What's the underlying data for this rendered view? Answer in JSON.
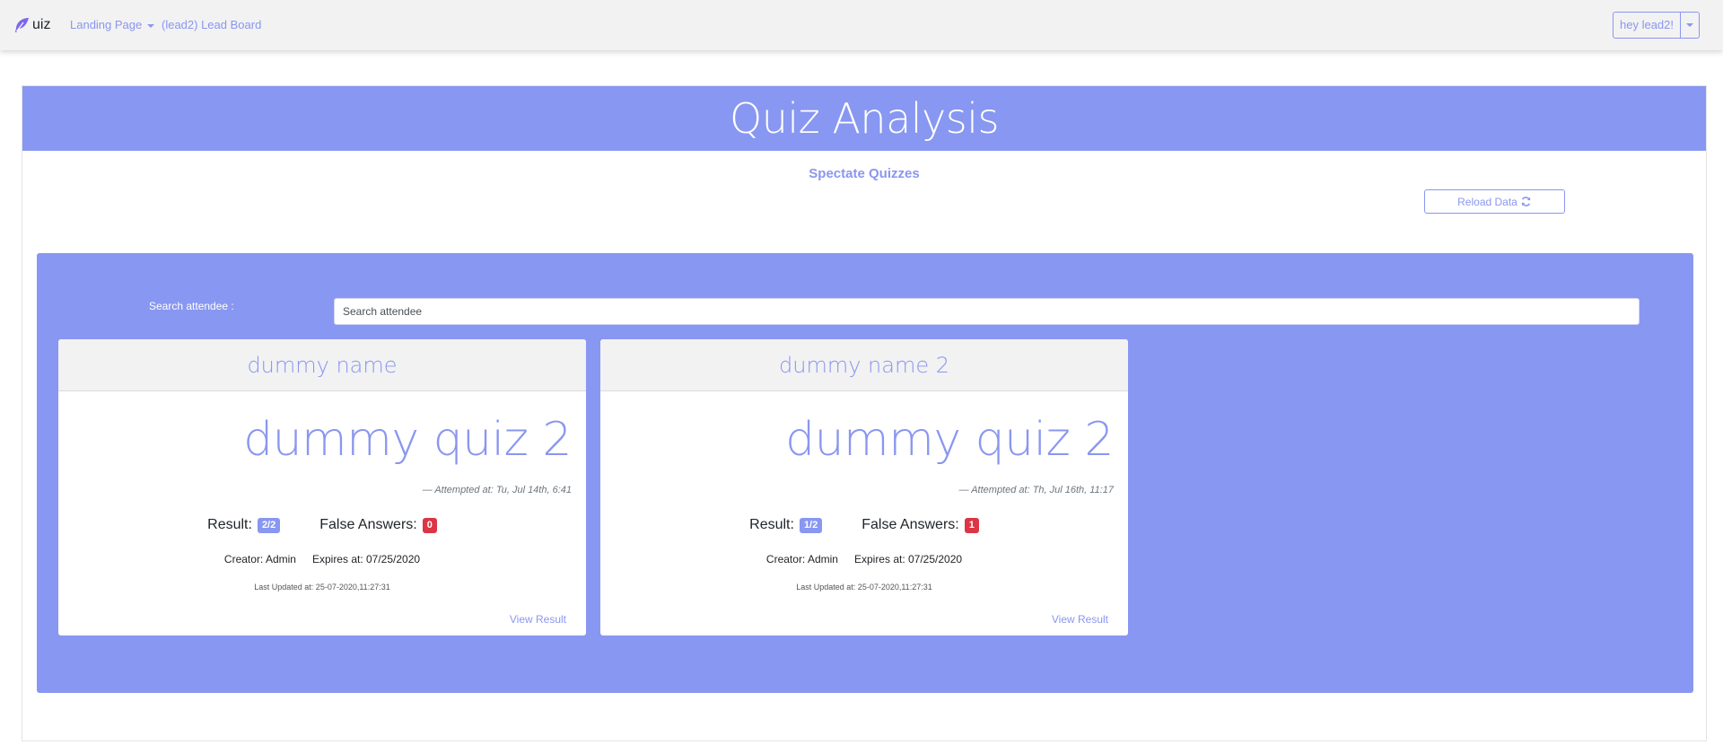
{
  "navbar": {
    "brand_text": "uiz",
    "landing_label": "Landing Page",
    "leadboard_label": "(lead2) Lead Board",
    "user_label": "hey lead2!"
  },
  "page": {
    "title": "Quiz Analysis",
    "subtitle": "Spectate Quizzes",
    "reload_label": "Reload Data"
  },
  "search": {
    "label": "Search attendee :",
    "placeholder": "Search attendee"
  },
  "cards": [
    {
      "attendee": "dummy name",
      "quiz": "dummy quiz 2",
      "attempted": "— Attempted at: Tu, Jul 14th, 6:41",
      "result_label": "Result:",
      "result_value": "2/2",
      "false_label": "False Answers:",
      "false_value": "0",
      "creator": "Creator: Admin",
      "expires": "Expires at: 07/25/2020",
      "updated": "Last Updated at: 25-07-2020,11:27:31",
      "view_label": "View Result"
    },
    {
      "attendee": "dummy name 2",
      "quiz": "dummy quiz 2",
      "attempted": "— Attempted at: Th, Jul 16th, 11:17",
      "result_label": "Result:",
      "result_value": "1/2",
      "false_label": "False Answers:",
      "false_value": "1",
      "creator": "Creator: Admin",
      "expires": "Expires at: 07/25/2020",
      "updated": "Last Updated at: 25-07-2020,11:27:31",
      "view_label": "View Result"
    }
  ],
  "colors": {
    "accent": "#8897f1",
    "link": "#8a96f0",
    "danger": "#dc3545",
    "navbar_bg": "#f2f2f2"
  },
  "icons": {
    "brand": "feather-icon",
    "reload": "refresh-icon",
    "dropdown": "caret-down-icon"
  }
}
